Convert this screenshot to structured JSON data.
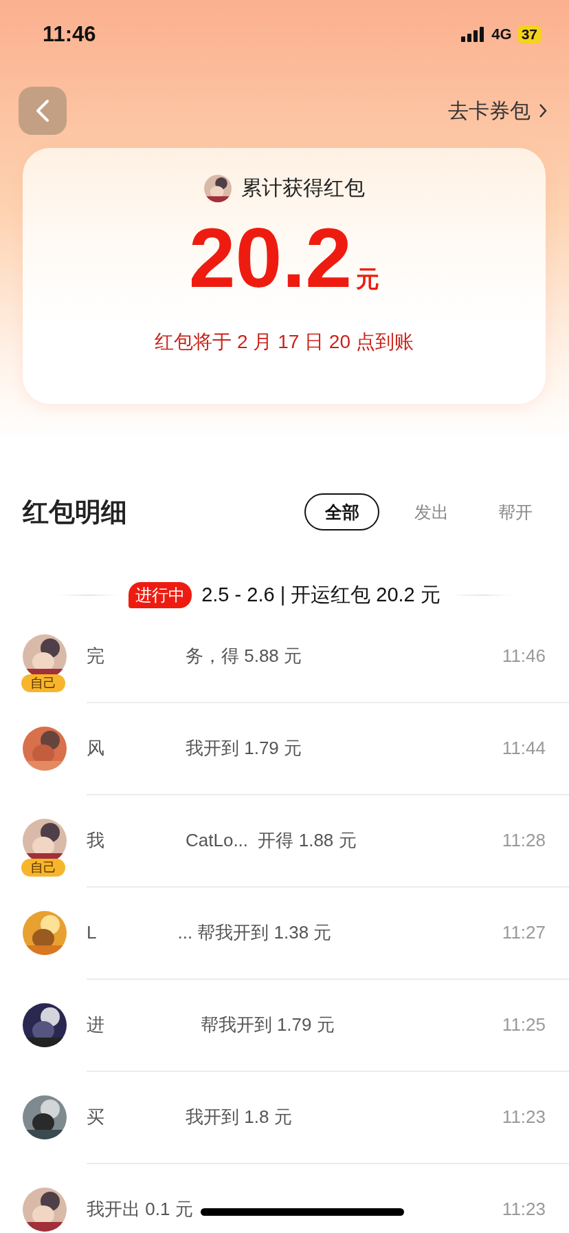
{
  "status_bar": {
    "time": "11:46",
    "network": "4G",
    "battery": "37"
  },
  "nav": {
    "link": "去卡券包"
  },
  "summary": {
    "title": "累计获得红包",
    "amount": "20.2",
    "unit": "元",
    "note": "红包将于 2 月 17 日 20 点到账"
  },
  "section": {
    "title": "红包明细"
  },
  "tabs": [
    {
      "label": "全部",
      "selected": true
    },
    {
      "label": "发出",
      "selected": false
    },
    {
      "label": "帮开",
      "selected": false
    }
  ],
  "period": {
    "badge": "进行中",
    "text": "2.5 - 2.6 | 开运红包  20.2 元"
  },
  "records": [
    {
      "lead": "完",
      "tail": "务，得 5.88 元",
      "time": "11:46",
      "badge": "自己"
    },
    {
      "lead": "风",
      "tail": "我开到 1.79 元",
      "time": "11:44"
    },
    {
      "lead": "我",
      "tail": "CatLo...  开得 1.88 元",
      "time": "11:28",
      "badge": "自己"
    },
    {
      "lead": "L",
      "tail": "... 帮我开到 1.38 元",
      "time": "11:27"
    },
    {
      "lead": "进",
      "tail": "   帮我开到 1.79 元",
      "time": "11:25"
    },
    {
      "lead": "买",
      "tail": "我开到 1.8 元",
      "time": "11:23"
    },
    {
      "lead": "我开出 0.1 元",
      "time": "11:23"
    }
  ]
}
